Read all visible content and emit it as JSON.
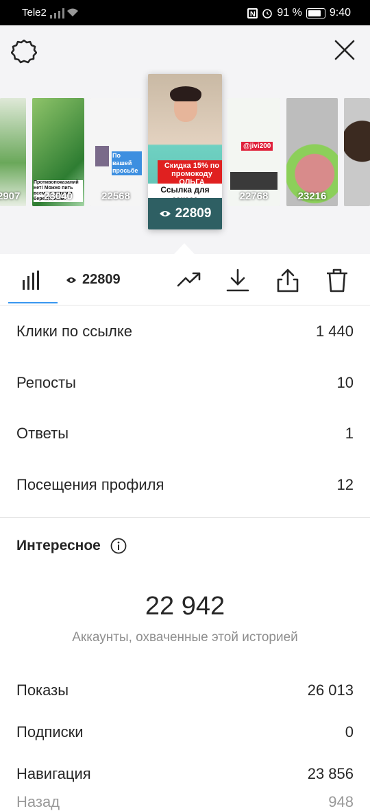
{
  "status_bar": {
    "carrier": "Tele2",
    "battery": "91 %",
    "time": "9:40",
    "icons": [
      "signal-icon",
      "wifi-icon",
      "nfc-icon",
      "alarm-icon",
      "battery-icon"
    ]
  },
  "header": {
    "settings_icon": "gear-icon",
    "close_icon": "close-icon"
  },
  "stories": [
    {
      "views": "2907"
    },
    {
      "views": "23040",
      "text": "Противопоказаний нет! Можно пить всем - и детям и беременным!"
    },
    {
      "views": "22568",
      "text": "По вашей просьбе"
    },
    {
      "views": "22809",
      "promo": "Скидка 15% по промокоду ОЛЬГА",
      "link_label": "Ссылка для заказа",
      "selected": true
    },
    {
      "views": "22768",
      "text": "@jivi200"
    },
    {
      "views": "23216"
    },
    {
      "views": ""
    }
  ],
  "tabs": {
    "selected_views": "22809",
    "insights_icon": "bar-chart-icon",
    "eye_icon": "eye-icon",
    "actions": [
      "trending-icon",
      "download-icon",
      "share-icon",
      "trash-icon"
    ]
  },
  "metrics": [
    {
      "label": "Клики по ссылке",
      "value": "1 440"
    },
    {
      "label": "Репосты",
      "value": "10"
    },
    {
      "label": "Ответы",
      "value": "1"
    },
    {
      "label": "Посещения профиля",
      "value": "12"
    }
  ],
  "discovery": {
    "title": "Интересное",
    "info_icon": "info-icon",
    "reach_value": "22 942",
    "reach_caption": "Аккаунты, охваченные этой историей",
    "rows": [
      {
        "label": "Показы",
        "value": "26 013"
      },
      {
        "label": "Подписки",
        "value": "0"
      },
      {
        "label": "Навигация",
        "value": "23 856"
      },
      {
        "label": "Назад",
        "value": "948"
      }
    ]
  },
  "colors": {
    "accent": "#3897f0",
    "selected_footer": "#2e5f63",
    "promo_red": "#e02020"
  }
}
